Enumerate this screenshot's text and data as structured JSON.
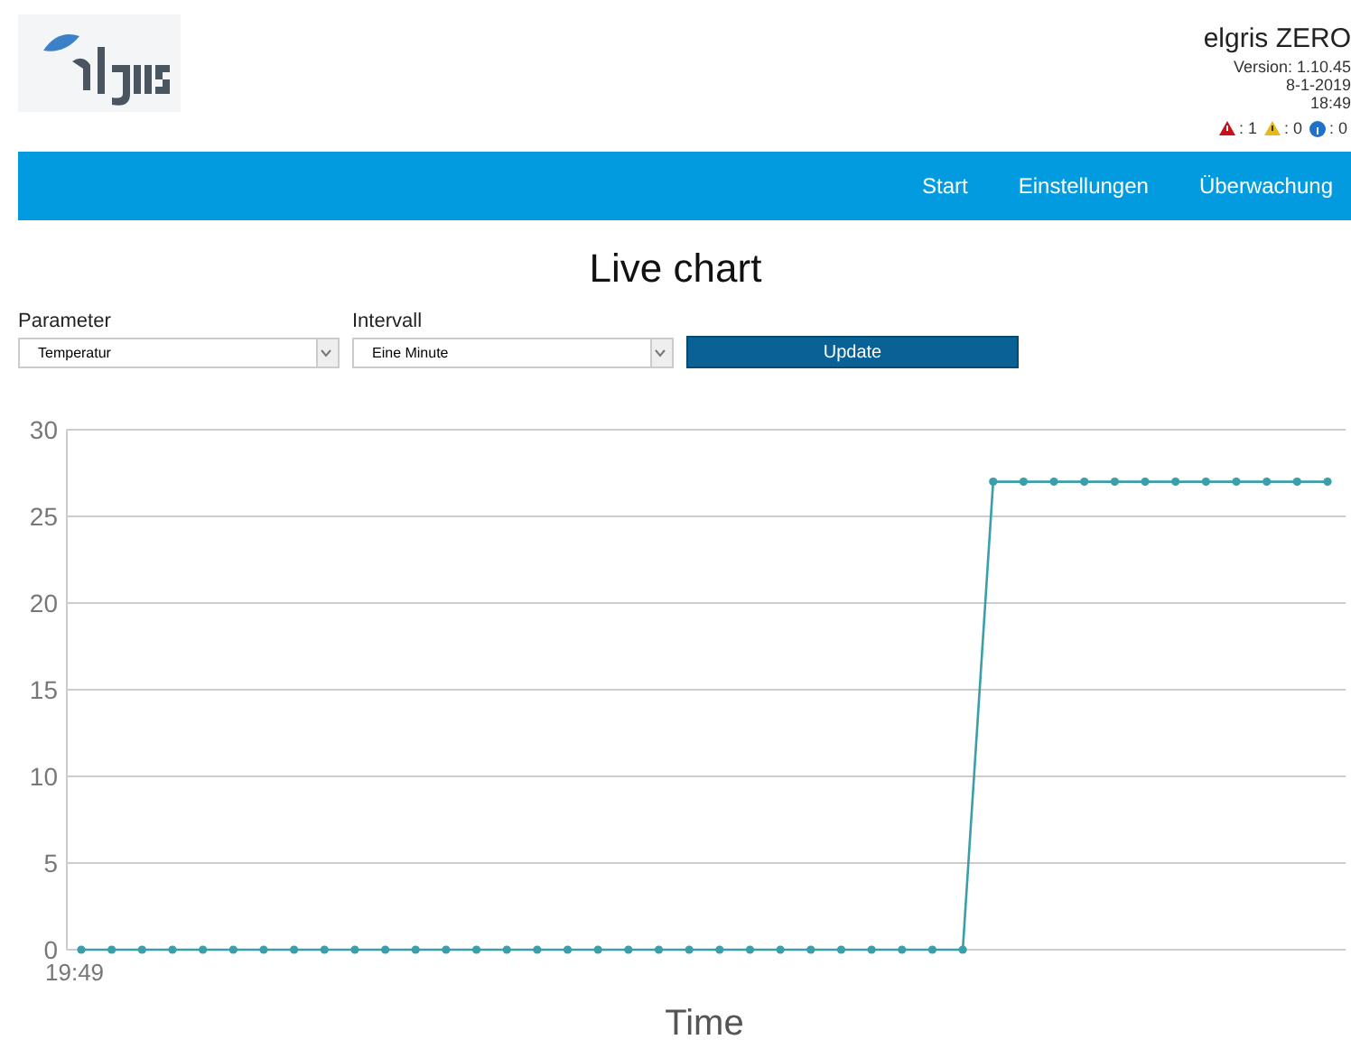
{
  "header": {
    "product": "elgris ZERO",
    "version": "Version: 1.10.45",
    "date": "8-1-2019",
    "time": "18:49",
    "alerts": [
      {
        "kind": "error",
        "count": ": 1"
      },
      {
        "kind": "warning",
        "count": ": 0"
      },
      {
        "kind": "info",
        "count": ": 0"
      }
    ]
  },
  "nav": {
    "items": [
      {
        "label": "Start"
      },
      {
        "label": "Einstellungen"
      },
      {
        "label": "Überwachung"
      }
    ]
  },
  "title": "Live chart",
  "form": {
    "fields": [
      {
        "label": "Parameter",
        "value": "Temperatur"
      },
      {
        "label": "Intervall",
        "value": "Eine Minute"
      }
    ],
    "button": "Update"
  },
  "chart_start_label": "19:49",
  "chart_data": {
    "type": "line",
    "xlabel": "Time",
    "grid": true,
    "series": [
      {
        "color": "#3a9fa8",
        "marker": "circle",
        "values": [
          0,
          0,
          0,
          0,
          0,
          0,
          0,
          0,
          0,
          0,
          0,
          0,
          0,
          0,
          0,
          0,
          0,
          0,
          0,
          0,
          0,
          0,
          0,
          0,
          0,
          0,
          0,
          0,
          0,
          0,
          27,
          27,
          27,
          27,
          27,
          27,
          27,
          27,
          27,
          27,
          27,
          27
        ]
      }
    ],
    "ylim": [
      0,
      30
    ],
    "yticks": [
      0,
      5,
      10,
      15,
      20,
      25,
      30
    ]
  }
}
